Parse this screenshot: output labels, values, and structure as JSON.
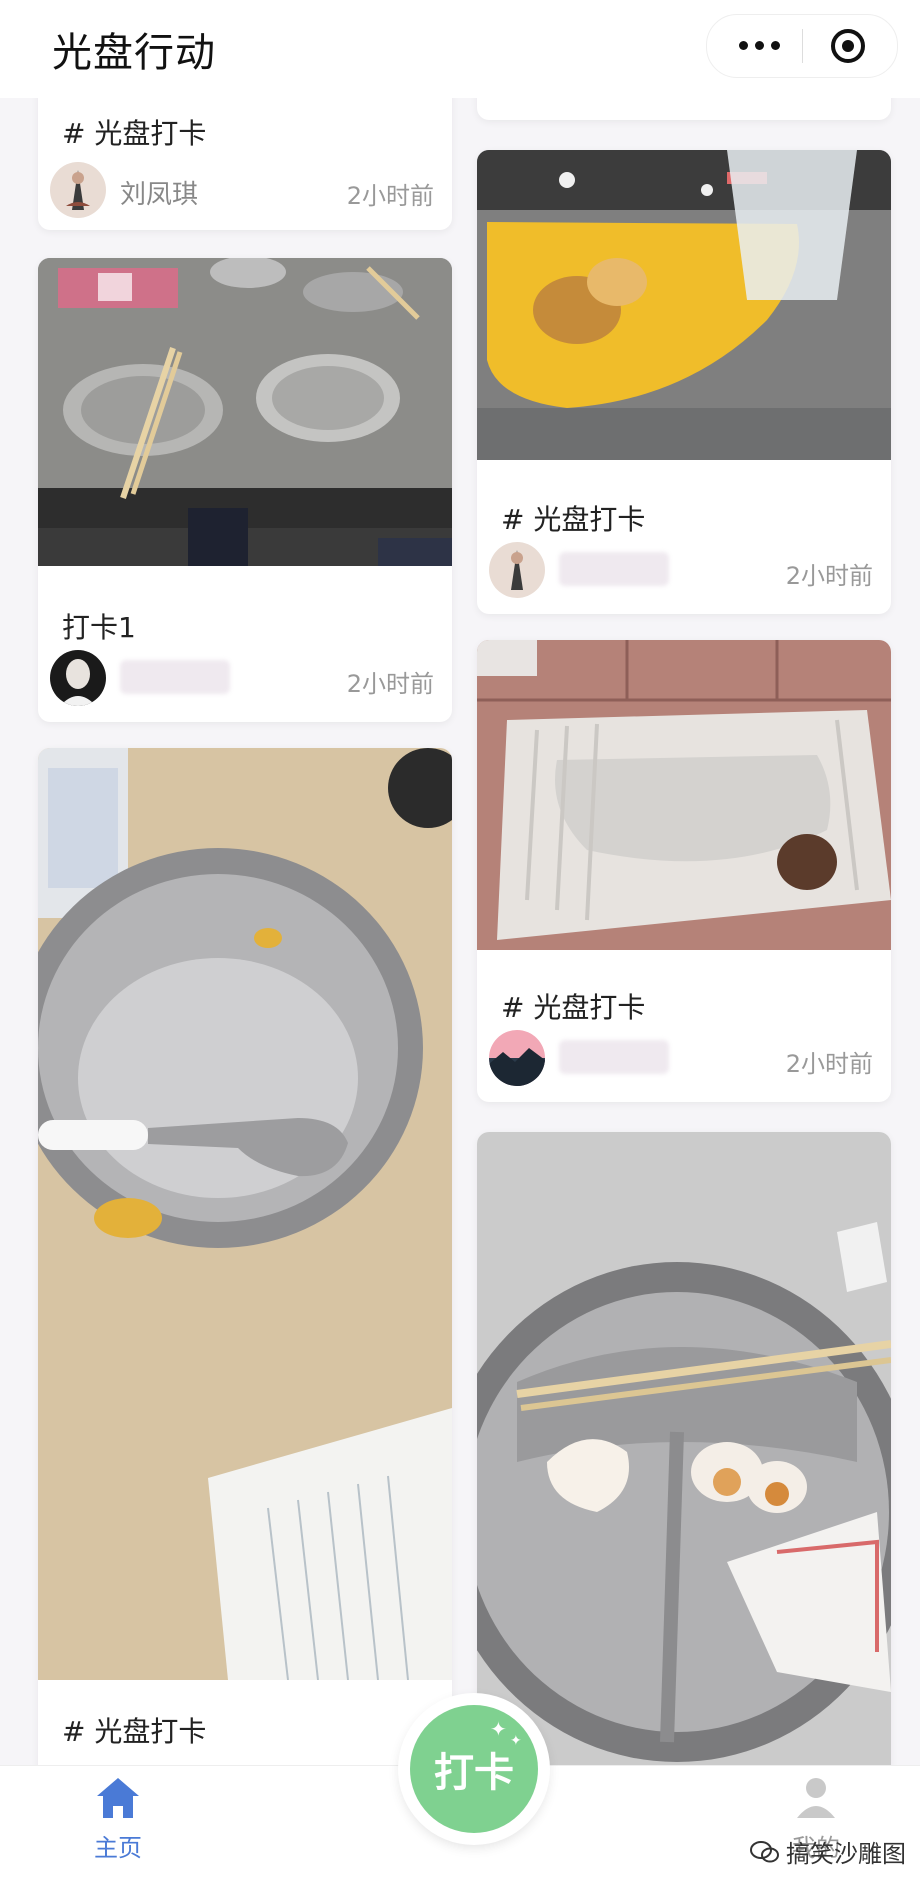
{
  "app": {
    "title": "光盘行动"
  },
  "feed": {
    "left": [
      {
        "caption": "# 光盘打卡",
        "author": "刘凤琪",
        "time": "2小时前"
      },
      {
        "caption": "打卡1",
        "author": "",
        "time": "2小时前"
      },
      {
        "caption": "# 光盘打卡"
      }
    ],
    "right": [
      {
        "caption": "# 光盘打卡",
        "author": "",
        "time": "2小时前"
      },
      {
        "caption": "# 光盘打卡",
        "author": "",
        "time": "2小时前"
      }
    ]
  },
  "tabbar": {
    "home": "主页",
    "checkin": "打卡",
    "mine": "我的"
  },
  "watermark": "搞笑沙雕图",
  "colors": {
    "accent": "#4a7ad6",
    "checkin": "#7fd190"
  }
}
